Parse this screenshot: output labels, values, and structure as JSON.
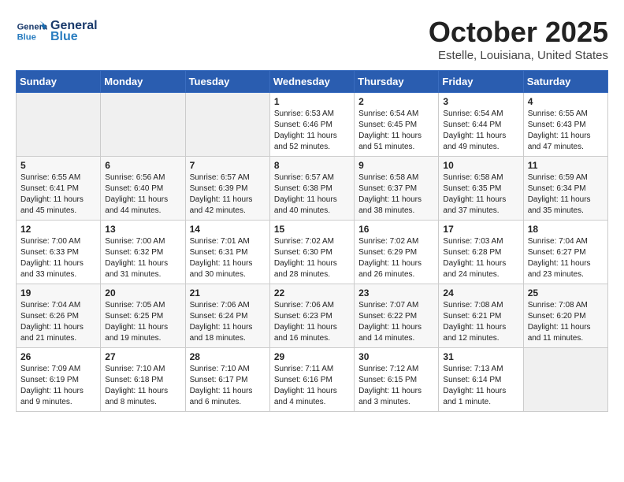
{
  "header": {
    "logo_line1": "General",
    "logo_line2": "Blue",
    "month": "October 2025",
    "location": "Estelle, Louisiana, United States"
  },
  "days_of_week": [
    "Sunday",
    "Monday",
    "Tuesday",
    "Wednesday",
    "Thursday",
    "Friday",
    "Saturday"
  ],
  "weeks": [
    [
      {
        "day": "",
        "info": ""
      },
      {
        "day": "",
        "info": ""
      },
      {
        "day": "",
        "info": ""
      },
      {
        "day": "1",
        "info": "Sunrise: 6:53 AM\nSunset: 6:46 PM\nDaylight: 11 hours\nand 52 minutes."
      },
      {
        "day": "2",
        "info": "Sunrise: 6:54 AM\nSunset: 6:45 PM\nDaylight: 11 hours\nand 51 minutes."
      },
      {
        "day": "3",
        "info": "Sunrise: 6:54 AM\nSunset: 6:44 PM\nDaylight: 11 hours\nand 49 minutes."
      },
      {
        "day": "4",
        "info": "Sunrise: 6:55 AM\nSunset: 6:43 PM\nDaylight: 11 hours\nand 47 minutes."
      }
    ],
    [
      {
        "day": "5",
        "info": "Sunrise: 6:55 AM\nSunset: 6:41 PM\nDaylight: 11 hours\nand 45 minutes."
      },
      {
        "day": "6",
        "info": "Sunrise: 6:56 AM\nSunset: 6:40 PM\nDaylight: 11 hours\nand 44 minutes."
      },
      {
        "day": "7",
        "info": "Sunrise: 6:57 AM\nSunset: 6:39 PM\nDaylight: 11 hours\nand 42 minutes."
      },
      {
        "day": "8",
        "info": "Sunrise: 6:57 AM\nSunset: 6:38 PM\nDaylight: 11 hours\nand 40 minutes."
      },
      {
        "day": "9",
        "info": "Sunrise: 6:58 AM\nSunset: 6:37 PM\nDaylight: 11 hours\nand 38 minutes."
      },
      {
        "day": "10",
        "info": "Sunrise: 6:58 AM\nSunset: 6:35 PM\nDaylight: 11 hours\nand 37 minutes."
      },
      {
        "day": "11",
        "info": "Sunrise: 6:59 AM\nSunset: 6:34 PM\nDaylight: 11 hours\nand 35 minutes."
      }
    ],
    [
      {
        "day": "12",
        "info": "Sunrise: 7:00 AM\nSunset: 6:33 PM\nDaylight: 11 hours\nand 33 minutes."
      },
      {
        "day": "13",
        "info": "Sunrise: 7:00 AM\nSunset: 6:32 PM\nDaylight: 11 hours\nand 31 minutes."
      },
      {
        "day": "14",
        "info": "Sunrise: 7:01 AM\nSunset: 6:31 PM\nDaylight: 11 hours\nand 30 minutes."
      },
      {
        "day": "15",
        "info": "Sunrise: 7:02 AM\nSunset: 6:30 PM\nDaylight: 11 hours\nand 28 minutes."
      },
      {
        "day": "16",
        "info": "Sunrise: 7:02 AM\nSunset: 6:29 PM\nDaylight: 11 hours\nand 26 minutes."
      },
      {
        "day": "17",
        "info": "Sunrise: 7:03 AM\nSunset: 6:28 PM\nDaylight: 11 hours\nand 24 minutes."
      },
      {
        "day": "18",
        "info": "Sunrise: 7:04 AM\nSunset: 6:27 PM\nDaylight: 11 hours\nand 23 minutes."
      }
    ],
    [
      {
        "day": "19",
        "info": "Sunrise: 7:04 AM\nSunset: 6:26 PM\nDaylight: 11 hours\nand 21 minutes."
      },
      {
        "day": "20",
        "info": "Sunrise: 7:05 AM\nSunset: 6:25 PM\nDaylight: 11 hours\nand 19 minutes."
      },
      {
        "day": "21",
        "info": "Sunrise: 7:06 AM\nSunset: 6:24 PM\nDaylight: 11 hours\nand 18 minutes."
      },
      {
        "day": "22",
        "info": "Sunrise: 7:06 AM\nSunset: 6:23 PM\nDaylight: 11 hours\nand 16 minutes."
      },
      {
        "day": "23",
        "info": "Sunrise: 7:07 AM\nSunset: 6:22 PM\nDaylight: 11 hours\nand 14 minutes."
      },
      {
        "day": "24",
        "info": "Sunrise: 7:08 AM\nSunset: 6:21 PM\nDaylight: 11 hours\nand 12 minutes."
      },
      {
        "day": "25",
        "info": "Sunrise: 7:08 AM\nSunset: 6:20 PM\nDaylight: 11 hours\nand 11 minutes."
      }
    ],
    [
      {
        "day": "26",
        "info": "Sunrise: 7:09 AM\nSunset: 6:19 PM\nDaylight: 11 hours\nand 9 minutes."
      },
      {
        "day": "27",
        "info": "Sunrise: 7:10 AM\nSunset: 6:18 PM\nDaylight: 11 hours\nand 8 minutes."
      },
      {
        "day": "28",
        "info": "Sunrise: 7:10 AM\nSunset: 6:17 PM\nDaylight: 11 hours\nand 6 minutes."
      },
      {
        "day": "29",
        "info": "Sunrise: 7:11 AM\nSunset: 6:16 PM\nDaylight: 11 hours\nand 4 minutes."
      },
      {
        "day": "30",
        "info": "Sunrise: 7:12 AM\nSunset: 6:15 PM\nDaylight: 11 hours\nand 3 minutes."
      },
      {
        "day": "31",
        "info": "Sunrise: 7:13 AM\nSunset: 6:14 PM\nDaylight: 11 hours\nand 1 minute."
      },
      {
        "day": "",
        "info": ""
      }
    ]
  ]
}
